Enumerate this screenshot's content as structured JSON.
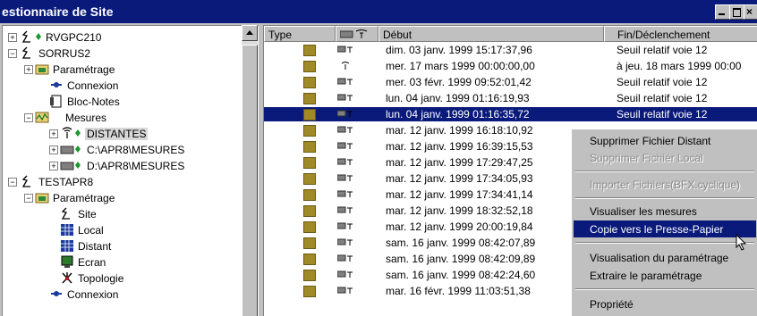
{
  "window": {
    "title": "estionnaire de Site"
  },
  "tree": {
    "nodes": [
      {
        "label": "RVGPC210",
        "icon": "site-icon"
      },
      {
        "label": "SORRUS2",
        "icon": "site-icon"
      },
      {
        "label": "Paramétrage",
        "icon": "folder-icon"
      },
      {
        "label": "Connexion",
        "icon": "connexion-icon"
      },
      {
        "label": "Bloc-Notes",
        "icon": "notebook-icon"
      },
      {
        "label": "Mesures",
        "icon": "mesures-icon"
      },
      {
        "label": "DISTANTES",
        "icon": "antenna-icon"
      },
      {
        "label": "C:\\APR8\\MESURES",
        "icon": "drive-icon"
      },
      {
        "label": "D:\\APR8\\MESURES",
        "icon": "drive-icon"
      },
      {
        "label": "TESTAPR8",
        "icon": "site-icon"
      },
      {
        "label": "Paramétrage",
        "icon": "folder-icon"
      },
      {
        "label": "Site",
        "icon": "site-icon"
      },
      {
        "label": "Local",
        "icon": "grid-icon"
      },
      {
        "label": "Distant",
        "icon": "grid-icon"
      },
      {
        "label": "Ecran",
        "icon": "screen-icon"
      },
      {
        "label": "Topologie",
        "icon": "topology-icon"
      },
      {
        "label": "Connexion",
        "icon": "connexion-icon"
      }
    ]
  },
  "list": {
    "headers": {
      "type": "Type",
      "debut": "Début",
      "fin": "Fin/Déclenchement"
    },
    "rows": [
      {
        "debut": "dim. 03 janv. 1999  15:17:37,96",
        "fin": "Seuil relatif voie 12"
      },
      {
        "debut": "mer. 17 mars 1999  00:00:00,00",
        "fin": "à jeu. 18 mars 1999 00:00"
      },
      {
        "debut": "mer. 03 févr. 1999  09:52:01,42",
        "fin": "Seuil relatif voie 12"
      },
      {
        "debut": "lun. 04 janv. 1999  01:16:19,93",
        "fin": "Seuil relatif voie 12"
      },
      {
        "debut": "lun. 04 janv. 1999  01:16:35,72",
        "fin": "Seuil relatif voie 12"
      },
      {
        "debut": "mar. 12 janv. 1999  16:18:10,92",
        "fin": ""
      },
      {
        "debut": "mar. 12 janv. 1999  16:39:15,53",
        "fin": ""
      },
      {
        "debut": "mar. 12 janv. 1999  17:29:47,25",
        "fin": ""
      },
      {
        "debut": "mar. 12 janv. 1999  17:34:05,93",
        "fin": ""
      },
      {
        "debut": "mar. 12 janv. 1999  17:34:41,14",
        "fin": ""
      },
      {
        "debut": "mar. 12 janv. 1999  18:32:52,18",
        "fin": ""
      },
      {
        "debut": "mar. 12 janv. 1999  20:00:19,84",
        "fin": ""
      },
      {
        "debut": "sam. 16 janv. 1999  08:42:07,89",
        "fin": ""
      },
      {
        "debut": "sam. 16 janv. 1999  08:42:09,89",
        "fin": ""
      },
      {
        "debut": "sam. 16 janv. 1999  08:42:24,60",
        "fin": ""
      },
      {
        "debut": "mar. 16 févr. 1999  11:03:51,38",
        "fin": ""
      }
    ]
  },
  "context_menu": {
    "items": [
      {
        "label": "Supprimer Fichier Distant",
        "enabled": true
      },
      {
        "label": "Supprimer Fichier Local",
        "enabled": false
      },
      {
        "label": "Importer Fichiers(BFX.cyclique)",
        "enabled": false
      },
      {
        "label": "Visualiser les mesures",
        "enabled": true
      },
      {
        "label": "Copie vers le Presse-Papier",
        "enabled": true,
        "highlighted": true
      },
      {
        "label": "Visualisation du paramétrage",
        "enabled": true
      },
      {
        "label": "Extraire le paramétrage",
        "enabled": true
      },
      {
        "label": "Propriété",
        "enabled": true
      }
    ]
  },
  "colors": {
    "titlebar": "#0a1a7a",
    "selection": "#0a1a7a",
    "type_icon": "#a08a28"
  }
}
